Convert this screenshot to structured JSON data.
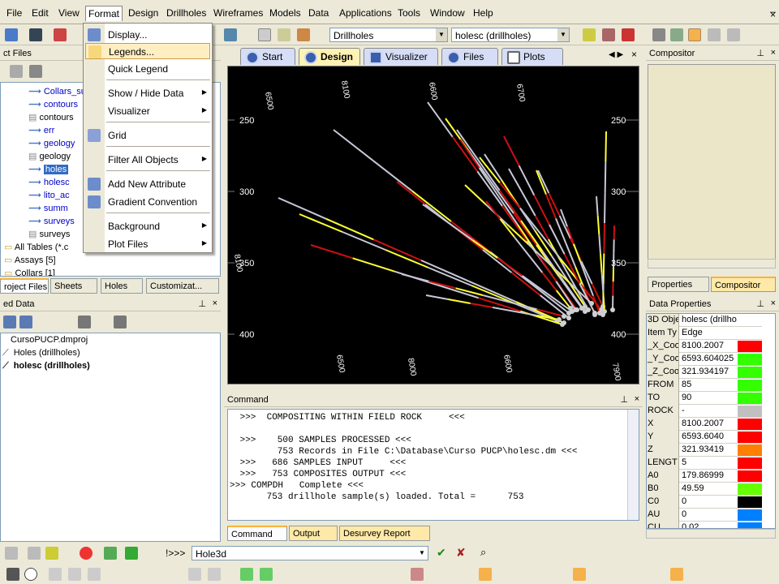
{
  "menubar": {
    "items": [
      "File",
      "Edit",
      "View",
      "Format",
      "Design",
      "Drillholes",
      "Wireframes",
      "Models",
      "Data",
      "Applications",
      "Tools",
      "Window",
      "Help"
    ],
    "active": "Format"
  },
  "toolbar": {
    "combo1": "Drillholes",
    "combo2": "holesc (drillholes)"
  },
  "project_files": {
    "title": "ct Files",
    "items": [
      "Collars_su",
      "contours",
      "contours",
      "err",
      "geology",
      "geology",
      "holes",
      "holesc",
      "lito_ac",
      "summ",
      "surveys",
      "surveys"
    ],
    "selected": "holes",
    "extra": [
      "All Tables (*.c",
      "Assays [5]",
      "Collars [1]"
    ],
    "tabs": [
      "roject Files",
      "Sheets",
      "Holes",
      "Customizat..."
    ]
  },
  "loaded_data": {
    "title": "ed Data",
    "items": [
      "CursoPUCP.dmproj",
      "Holes (drillholes)",
      "holesc (drillholes)"
    ]
  },
  "format_menu": {
    "items": [
      {
        "label": "Display...",
        "icon": "display-icon",
        "submenu": false
      },
      {
        "label": "Legends...",
        "icon": "legends-icon",
        "submenu": false,
        "highlight": true
      },
      {
        "label": "Quick Legend",
        "submenu": false
      },
      {
        "label": "Show / Hide Data",
        "submenu": true
      },
      {
        "label": "Visualizer",
        "submenu": true
      },
      {
        "label": "Grid",
        "icon": "grid-icon",
        "submenu": false
      },
      {
        "label": "Filter All Objects",
        "submenu": true
      },
      {
        "label": "Add New Attribute",
        "icon": "add-attribute-icon",
        "submenu": false
      },
      {
        "label": "Gradient Convention",
        "icon": "gradient-icon",
        "submenu": false
      },
      {
        "label": "Background",
        "submenu": true
      },
      {
        "label": "Plot Files",
        "submenu": true
      }
    ]
  },
  "doc_tabs": [
    "Start",
    "Design",
    "Visualizer",
    "Files",
    "Plots"
  ],
  "active_doc_tab": "Design",
  "viewport": {
    "top_labels": [
      "6500",
      "8100",
      "6600",
      "6700"
    ],
    "bottom_labels": [
      "6500",
      "8000",
      "6600",
      "7900"
    ],
    "left_axis": [
      "250",
      "300",
      "350",
      "400"
    ],
    "right_axis": [
      "250",
      "300",
      "350",
      "400"
    ],
    "side_label": "8100"
  },
  "command": {
    "title": "Command",
    "lines": [
      " >>>  COMPOSITING WITHIN FIELD ROCK     <<<",
      "",
      " >>>    500 SAMPLES PROCESSED <<<",
      "        753 Records in File C:\\Database\\Curso PUCP\\holesc.dm <<<",
      " >>>   686 SAMPLES INPUT     <<<",
      " >>>   753 COMPOSITES OUTPUT <<<",
      ">>> COMPDH   Complete <<<",
      "      753 drillhole sample(s) loaded. Total =      753"
    ],
    "tabs": [
      "Command",
      "Output",
      "Desurvey Report"
    ]
  },
  "compositor": {
    "title": "Compositor",
    "tabs": [
      "Properties",
      "Compositor"
    ]
  },
  "data_properties": {
    "title": "Data Properties",
    "rows": [
      {
        "k": "3D Obje",
        "v": "holesc (drillho",
        "color": ""
      },
      {
        "k": "Item Ty",
        "v": "Edge",
        "color": ""
      },
      {
        "k": "_X_Coo",
        "v": "8100.2007",
        "color": "#ff0000"
      },
      {
        "k": "_Y_Coo",
        "v": "6593.604025",
        "color": "#33ff00"
      },
      {
        "k": "_Z_Coo",
        "v": "321.934197",
        "color": "#33ff00"
      },
      {
        "k": "FROM",
        "v": "85",
        "color": "#33ff00"
      },
      {
        "k": "TO",
        "v": "90",
        "color": "#33ff00"
      },
      {
        "k": "ROCK",
        "v": "-",
        "color": "#c0c0c0"
      },
      {
        "k": "X",
        "v": "8100.2007",
        "color": "#ff0000"
      },
      {
        "k": "Y",
        "v": "6593.6040",
        "color": "#ff0000"
      },
      {
        "k": "Z",
        "v": "321.93419",
        "color": "#ff7f00"
      },
      {
        "k": "LENGT",
        "v": "5",
        "color": "#ff0000"
      },
      {
        "k": "A0",
        "v": "179.86999",
        "color": "#ff0000"
      },
      {
        "k": "B0",
        "v": "49.59",
        "color": "#66ff00"
      },
      {
        "k": "C0",
        "v": "0",
        "color": "#000000"
      },
      {
        "k": "AU",
        "v": "0",
        "color": "#0080ff"
      },
      {
        "k": "CU",
        "v": "0.02",
        "color": "#0080ff"
      }
    ]
  },
  "bottom_bar": {
    "prompt": "!>>>",
    "command_value": "Hole3d"
  }
}
